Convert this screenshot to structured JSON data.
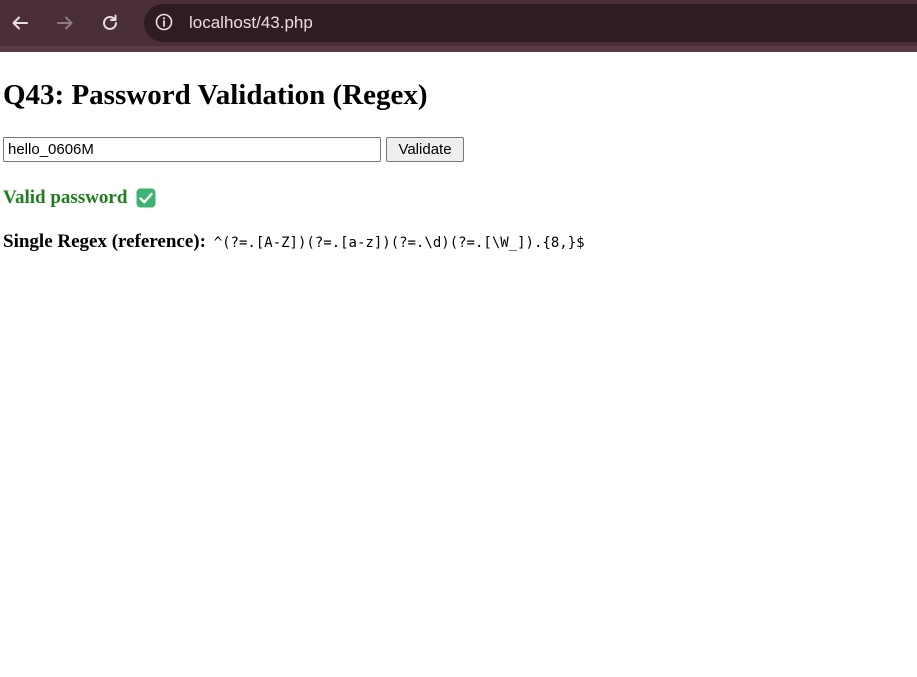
{
  "browser": {
    "url": "localhost/43.php",
    "icons": {
      "back": "arrow-left-icon",
      "forward": "arrow-right-icon",
      "reload": "reload-icon",
      "site_info": "info-icon"
    }
  },
  "page": {
    "title": "Q43: Password Validation (Regex)",
    "password_input": {
      "value": "hello_0606M",
      "placeholder": ""
    },
    "validate_label": "Validate",
    "result": {
      "text": "Valid password",
      "icon": "check-mark-icon",
      "color": "#1e7e1e"
    },
    "regex": {
      "label": "Single Regex (reference):",
      "pattern": "^(?=.[A-Z])(?=.[a-z])(?=.\\d)(?=.[\\W_]).{8,}$"
    }
  },
  "colors": {
    "browser_bar": "#4a2f3a",
    "omnibox": "#2f1b24",
    "check_green": "#3cb371"
  }
}
